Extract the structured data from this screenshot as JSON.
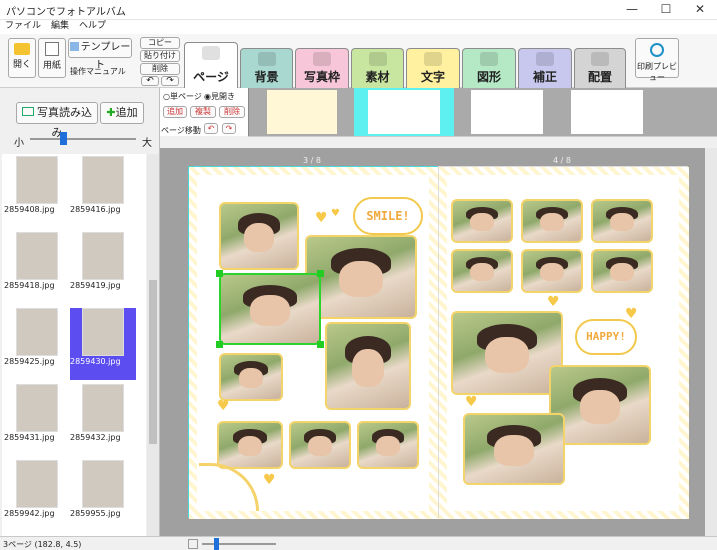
{
  "window": {
    "title": "パソコンでフォトアルバム",
    "minimize": "—",
    "maximize": "☐",
    "close": "✕"
  },
  "menu": [
    "ファイル",
    "編集",
    "ヘルプ"
  ],
  "toolbar": {
    "open": "開く",
    "paper": "用紙",
    "template": "テンプレート",
    "manual": "操作マニュアル",
    "copy": "コピー",
    "paste": "貼り付け",
    "delete": "削除",
    "undo": "↶",
    "redo": "↷",
    "print_preview": "印刷プレビュー"
  },
  "tabs": [
    {
      "label": "ページ",
      "color": "#ffffff",
      "active": true
    },
    {
      "label": "背景",
      "color": "#a8d8d0"
    },
    {
      "label": "写真枠",
      "color": "#f7c6d8"
    },
    {
      "label": "素材",
      "color": "#c8e6a0"
    },
    {
      "label": "文字",
      "color": "#fff1a0"
    },
    {
      "label": "図形",
      "color": "#b5e8c5"
    },
    {
      "label": "補正",
      "color": "#c8c8ef"
    },
    {
      "label": "配置",
      "color": "#d4d4d4"
    }
  ],
  "left_panel": {
    "load_photo": "写真読み込み",
    "add": "追加",
    "size_small": "小",
    "size_large": "大",
    "thumbs": [
      {
        "file": "2859408.jpg"
      },
      {
        "file": "2859416.jpg"
      },
      {
        "file": "2859418.jpg"
      },
      {
        "file": "2859419.jpg"
      },
      {
        "file": "2859425.jpg"
      },
      {
        "file": "2859430.jpg",
        "selected": true
      },
      {
        "file": "2859431.jpg"
      },
      {
        "file": "2859432.jpg"
      },
      {
        "file": "2859942.jpg"
      },
      {
        "file": "2859955.jpg"
      }
    ]
  },
  "page_controls": {
    "single": "単ページ",
    "spread": "見開き",
    "add": "追加",
    "duplicate": "複製",
    "delete": "削除",
    "move": "ページ移動"
  },
  "canvas": {
    "left_page_label": "3 / 8",
    "right_page_label": "4 / 8",
    "bubble_left": "SMILE!",
    "bubble_right": "HAPPY!"
  },
  "status": {
    "text": "3ページ (182.8, 4.5)"
  }
}
